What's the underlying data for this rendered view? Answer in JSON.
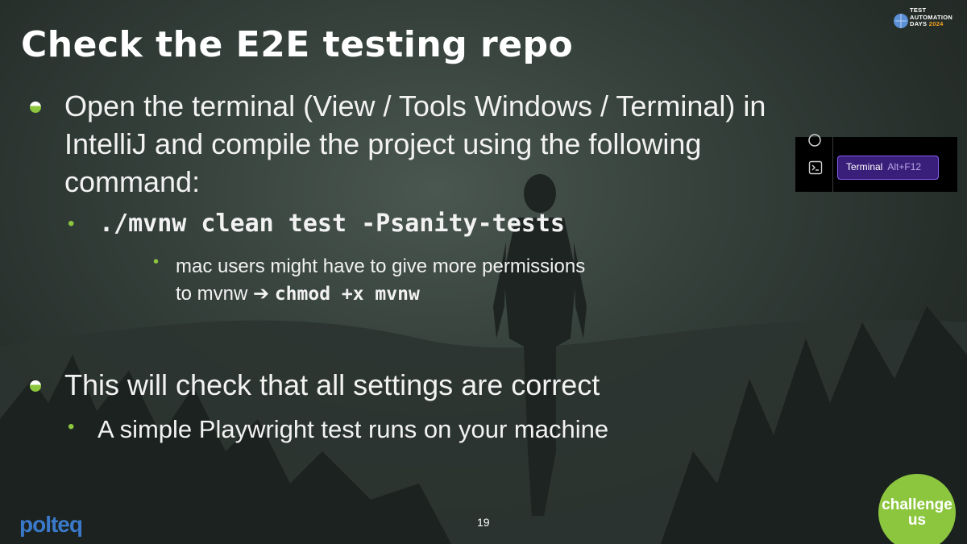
{
  "slide": {
    "title": "Check the E2E testing repo",
    "page_number": "19"
  },
  "bullets": {
    "b1": {
      "line1": "Open the terminal (View / Tools Windows / Terminal) in",
      "line2": "IntelliJ and compile the project using the following",
      "line3": "command:",
      "sub1_code": "./mvnw clean test -Psanity-tests",
      "sub1_note_line1": "mac users might have to give more permissions",
      "sub1_note_line2_prefix": "to mvnw",
      "sub1_note_arrow": "➔",
      "sub1_note_code": "chmod +x mvnw"
    },
    "b2": {
      "text": "This will check that all settings are correct",
      "sub1": "A simple Playwright test runs on your machine"
    }
  },
  "ide_screenshot": {
    "button_label": "Terminal",
    "shortcut": "Alt+F12"
  },
  "logos": {
    "conference_line1": "TEST",
    "conference_line2": "AUTOMATION",
    "conference_line3": "DAYS",
    "conference_year": "2024",
    "company": "polteq",
    "badge_line1": "challenge",
    "badge_line2": "us"
  },
  "colors": {
    "accent_green": "#8dc63f",
    "ide_button_border": "#8a5cf5",
    "company_blue": "#3a79c9"
  }
}
